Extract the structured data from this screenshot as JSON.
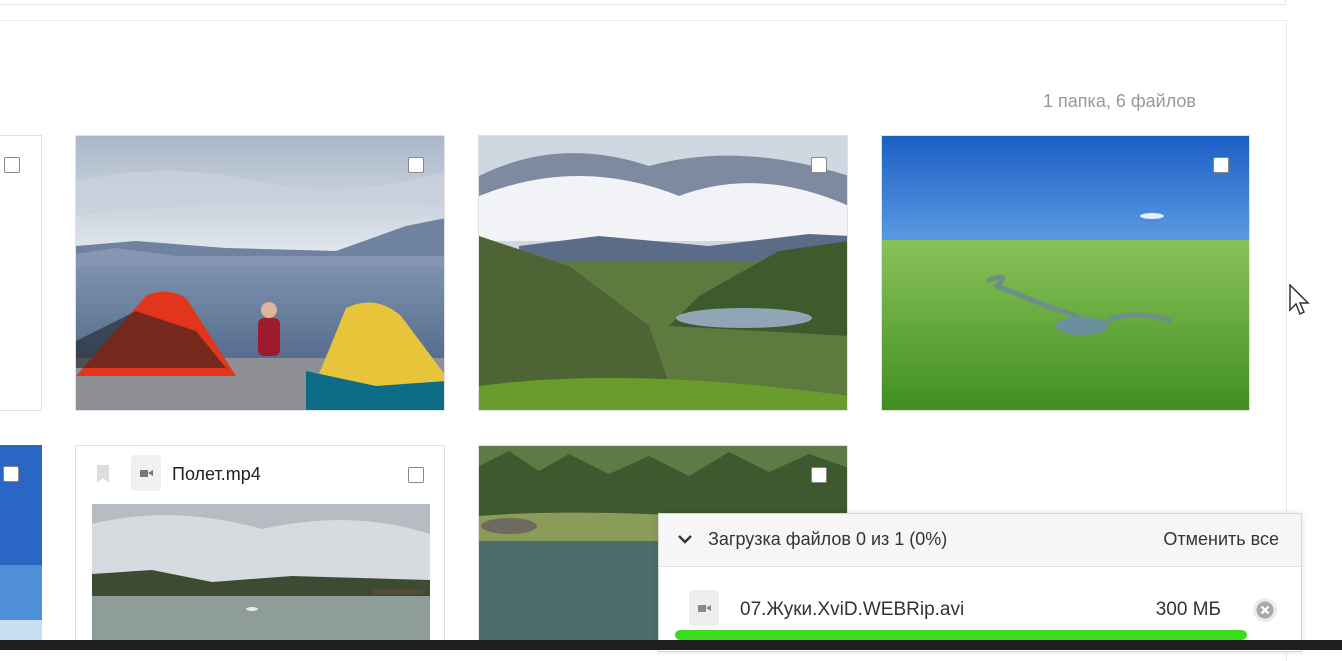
{
  "folder": {
    "summary": "1 папка, 6 файлов"
  },
  "files": [
    {
      "type": "image",
      "subject": "lake-tents"
    },
    {
      "type": "image",
      "subject": "mountain-valley"
    },
    {
      "type": "image",
      "subject": "green-steppe"
    },
    {
      "type": "video",
      "name": "Полет.mp4"
    },
    {
      "type": "image",
      "subject": "forest-lake"
    }
  ],
  "upload": {
    "title": "Загрузка файлов 0 из 1 (0%)",
    "cancel_all_label": "Отменить все",
    "item": {
      "name": "07.Жуки.XviD.WEBRip.avi",
      "size": "300 МБ",
      "progress_percent": 100
    }
  },
  "colors": {
    "progress": "#3ddc1e",
    "checkbox_border": "#888888"
  },
  "icons": [
    "bookmark-icon",
    "video-file-icon",
    "chevron-down-icon",
    "close-circle-icon",
    "mouse-cursor-icon"
  ]
}
